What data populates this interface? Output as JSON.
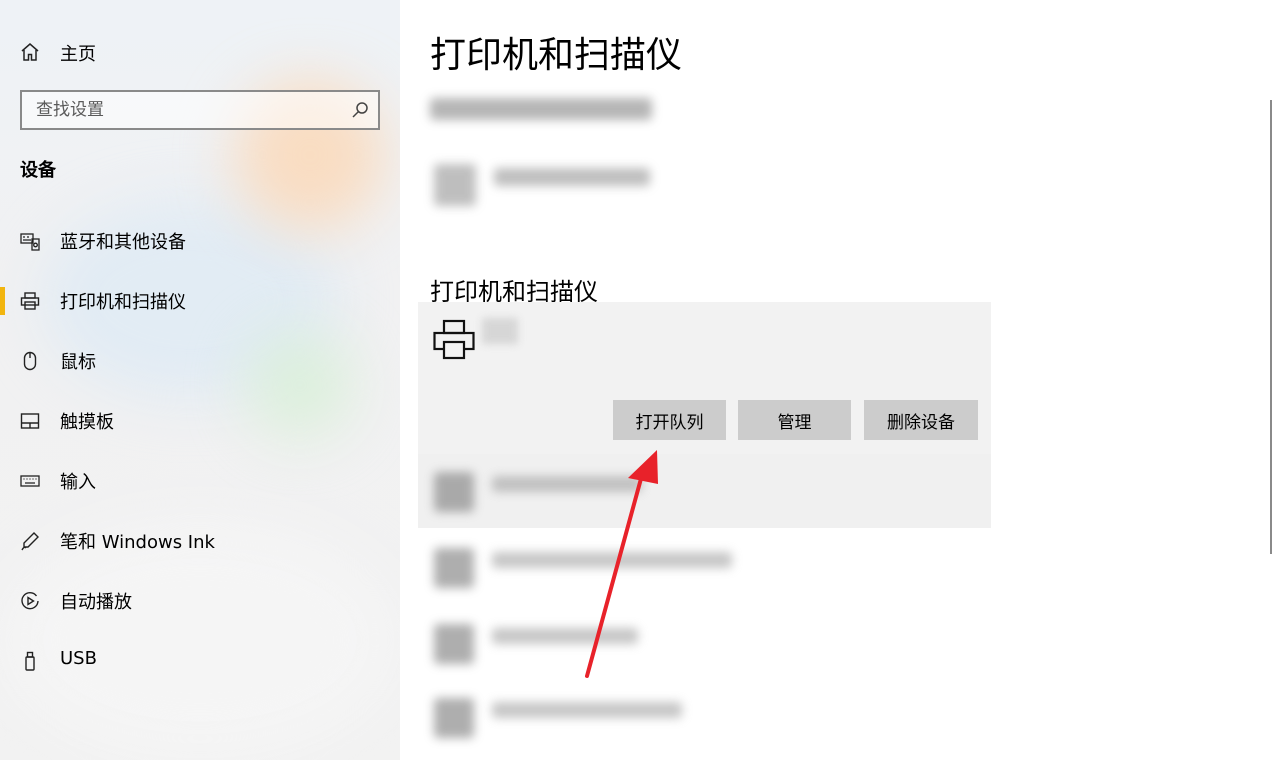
{
  "sidebar": {
    "home_label": "主页",
    "search_placeholder": "查找设置",
    "section_title": "设备",
    "items": [
      {
        "label": "蓝牙和其他设备",
        "icon": "bluetooth-devices-icon"
      },
      {
        "label": "打印机和扫描仪",
        "icon": "printer-icon",
        "active": true
      },
      {
        "label": "鼠标",
        "icon": "mouse-icon"
      },
      {
        "label": "触摸板",
        "icon": "touchpad-icon"
      },
      {
        "label": "输入",
        "icon": "keyboard-icon"
      },
      {
        "label": "笔和 Windows Ink",
        "icon": "pen-icon"
      },
      {
        "label": "自动播放",
        "icon": "autoplay-icon"
      },
      {
        "label": "USB",
        "icon": "usb-icon"
      }
    ]
  },
  "main": {
    "page_title": "打印机和扫描仪",
    "section_title": "打印机和扫描仪",
    "selected_printer": {
      "icon": "printer-icon",
      "buttons": {
        "open_queue": "打开队列",
        "manage": "管理",
        "remove_device": "删除设备"
      }
    }
  },
  "colors": {
    "active_indicator": "#f2b50f",
    "button_bg": "#cccccc",
    "card_bg": "#f2f2f2",
    "annotation_arrow": "#e8222a"
  }
}
